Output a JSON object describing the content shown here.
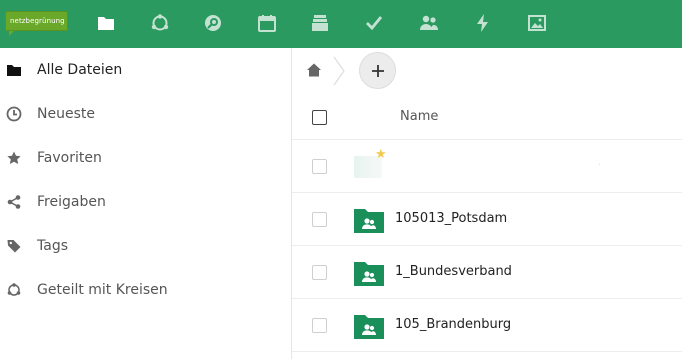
{
  "colors": {
    "brand": "#2b9a60",
    "folder": "#1a8f5a",
    "star": "#f2c94c"
  },
  "header": {
    "logo_text": "netzbegrünung",
    "apps": [
      {
        "name": "files",
        "icon": "folder-icon"
      },
      {
        "name": "circles",
        "icon": "circles-icon"
      },
      {
        "name": "search",
        "icon": "magnifier-icon"
      },
      {
        "name": "calendar",
        "icon": "calendar-icon"
      },
      {
        "name": "deck",
        "icon": "deck-icon"
      },
      {
        "name": "tasks",
        "icon": "checkmark-icon"
      },
      {
        "name": "contacts",
        "icon": "contacts-icon"
      },
      {
        "name": "activity",
        "icon": "lightning-icon"
      },
      {
        "name": "gallery",
        "icon": "image-icon"
      }
    ]
  },
  "sidebar": {
    "items": [
      {
        "label": "Alle Dateien",
        "icon": "folder-icon"
      },
      {
        "label": "Neueste",
        "icon": "clock-icon"
      },
      {
        "label": "Favoriten",
        "icon": "star-icon"
      },
      {
        "label": "Freigaben",
        "icon": "share-icon"
      },
      {
        "label": "Tags",
        "icon": "tag-icon"
      },
      {
        "label": "Geteilt mit Kreisen",
        "icon": "circles-icon"
      }
    ]
  },
  "breadcrumb": {
    "home_icon": "home-icon",
    "add_icon": "plus-icon"
  },
  "filelist": {
    "columns": {
      "name": "Name"
    },
    "rows": [
      {
        "name": "105013_Potsdam",
        "icon": "shared-folder-icon"
      },
      {
        "name": "1_Bundesverband",
        "icon": "shared-folder-icon"
      },
      {
        "name": "105_Brandenburg",
        "icon": "shared-folder-icon"
      }
    ]
  }
}
